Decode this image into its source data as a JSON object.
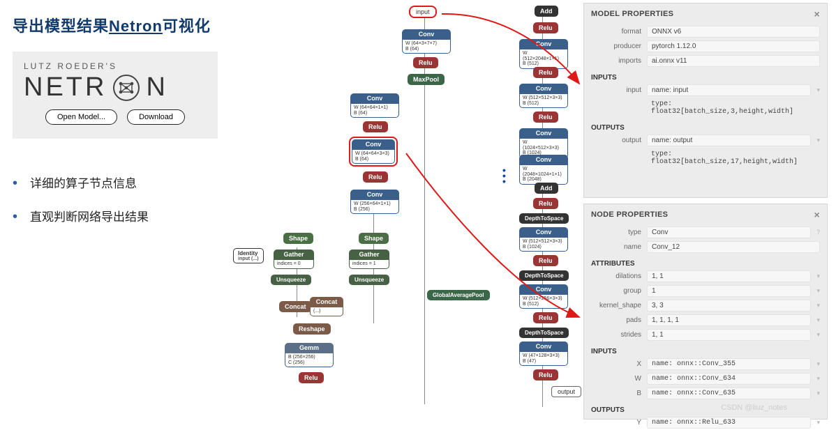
{
  "title_prefix": "导出模型结果",
  "title_mid": "Netron",
  "title_suffix": "可视化",
  "netron": {
    "subtitle": "LUTZ ROEDER'S",
    "word_a": "NETR",
    "word_b": "N",
    "open_btn": "Open Model...",
    "download_btn": "Download"
  },
  "bullets": [
    "详细的算子节点信息",
    "直观判断网络导出结果"
  ],
  "graph": {
    "input": "input",
    "output": "output",
    "conv": "Conv",
    "relu": "Relu",
    "maxpool": "MaxPool",
    "shape": "Shape",
    "gather": "Gather",
    "unsqueeze": "Unsqueeze",
    "concat": "Concat",
    "reshape": "Reshape",
    "gemm": "Gemm",
    "gap": "GlobalAveragePool",
    "d2s": "DepthToSpace",
    "add": "Add",
    "identity": "Identity",
    "ident_body": "input (...)",
    "gather_i0": "indices = 0",
    "gather_i1": "indices = 1",
    "concat_body": "(...)",
    "conv1_w": "W (64×3×7×7)",
    "conv1_b": "B (64)",
    "conv2_w": "W (64×64×1×1)",
    "conv2_b": "B (64)",
    "conv3_w": "W (64×64×3×3)",
    "conv3_b": "B (64)",
    "conv4_w": "W (256×64×1×1)",
    "conv4_b": "B (256)",
    "gemm_b": "B (256×256)",
    "gemm_c": "C (256)",
    "r_conv1_w": "W (512×2048×1×1)",
    "r_conv1_b": "B (512)",
    "r_conv2_w": "W (512×512×3×3)",
    "r_conv2_b": "B (512)",
    "r_conv3_w": "W (1024×512×3×3)",
    "r_conv3_b": "B (1024)",
    "r_conv4_w": "W (2048×1024×1×1)",
    "r_conv4_b": "B (2048)",
    "r_conv5_w": "W (512×512×3×3)",
    "r_conv5_b": "B (1024)",
    "r_conv6_w": "W (512×256×3×3)",
    "r_conv6_b": "B (512)",
    "r_conv7_w": "W (47×128×3×3)",
    "r_conv7_b": "B (47)"
  },
  "model_panel": {
    "title": "MODEL PROPERTIES",
    "format_lbl": "format",
    "format_val": "ONNX v6",
    "producer_lbl": "producer",
    "producer_val": "pytorch 1.12.0",
    "imports_lbl": "imports",
    "imports_val": "ai.onnx v11",
    "inputs_head": "INPUTS",
    "input_lbl": "input",
    "input_name": "name: input",
    "input_type": "type: float32[batch_size,3,height,width]",
    "outputs_head": "OUTPUTS",
    "output_lbl": "output",
    "output_name": "name: output",
    "output_type": "type: float32[batch_size,17,height,width]"
  },
  "node_panel": {
    "title": "NODE PROPERTIES",
    "type_lbl": "type",
    "type_val": "Conv",
    "name_lbl": "name",
    "name_val": "Conv_12",
    "attr_head": "ATTRIBUTES",
    "dil_lbl": "dilations",
    "dil_val": "1, 1",
    "grp_lbl": "group",
    "grp_val": "1",
    "ks_lbl": "kernel_shape",
    "ks_val": "3, 3",
    "pad_lbl": "pads",
    "pad_val": "1, 1, 1, 1",
    "str_lbl": "strides",
    "str_val": "1, 1",
    "inputs_head": "INPUTS",
    "x_lbl": "X",
    "x_val": "name: onnx::Conv_355",
    "w_lbl": "W",
    "w_val": "name: onnx::Conv_634",
    "b_lbl": "B",
    "b_val": "name: onnx::Conv_635",
    "outputs_head": "OUTPUTS",
    "y_lbl": "Y",
    "y_val": "name: onnx::Relu_633"
  },
  "watermark": "CSDN @liuz_notes"
}
